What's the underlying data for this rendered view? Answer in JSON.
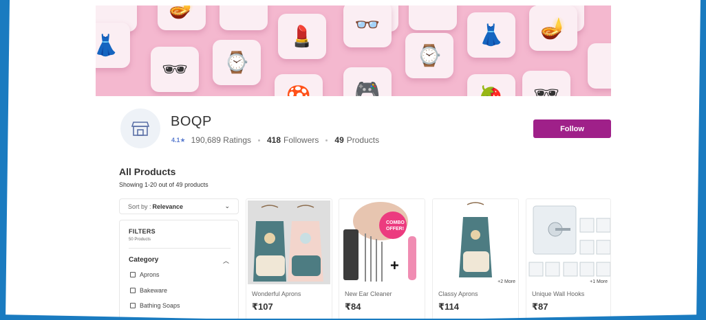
{
  "shop": {
    "name": "BOQP",
    "rating": "4.1★",
    "ratings_count": "190,689 Ratings",
    "followers_count": "418",
    "followers_label": "Followers",
    "products_count": "49",
    "products_label": "Products",
    "follow_label": "Follow",
    "logo_icon": "storefront-icon"
  },
  "listing": {
    "title": "All Products",
    "showing": "Showing 1-20 out of 49 products",
    "sort_prefix": "Sort by :",
    "sort_value": "Relevance"
  },
  "filters": {
    "title": "FILTERS",
    "count": "50 Products",
    "category_label": "Category",
    "options": [
      "Aprons",
      "Bakeware",
      "Bathing Soaps"
    ]
  },
  "products": [
    {
      "name": "Wonderful Aprons",
      "price": "₹107",
      "more": ""
    },
    {
      "name": "New Ear Cleaner",
      "price": "₹84",
      "more": ""
    },
    {
      "name": "Classy Aprons",
      "price": "₹114",
      "more": "+2 More"
    },
    {
      "name": "Unique Wall Hooks",
      "price": "₹87",
      "more": "+1 More"
    }
  ],
  "colors": {
    "accent": "#9f2089",
    "banner": "#f4b8cf",
    "rating": "#5a7ccf",
    "frame": "#1a7bc0"
  }
}
